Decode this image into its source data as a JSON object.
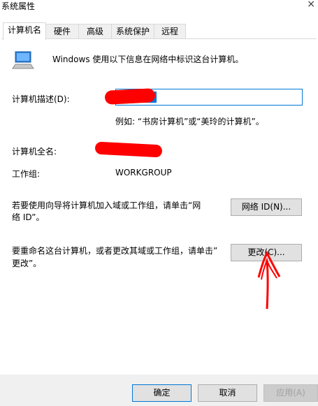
{
  "window": {
    "title": "系统属性",
    "close_glyph": "×"
  },
  "tabs": [
    "计算机名",
    "硬件",
    "高级",
    "系统保护",
    "远程"
  ],
  "intro_text": "Windows 使用以下信息在网络中标识这台计算机。",
  "description": {
    "label": "计算机描述(D):",
    "example": "例如: “书房计算机”或“美玲的计算机”。"
  },
  "full_name": {
    "label": "计算机全名:"
  },
  "workgroup": {
    "label": "工作组:",
    "value": "WORKGROUP"
  },
  "network_section": {
    "text_line1": "若要使用向导将计算机加入域或工作组，请单击“网",
    "text_line2": "络 ID”。",
    "button": "网络 ID(N)..."
  },
  "rename_section": {
    "text_line1": "要重命名这台计算机，或者更改其域或工作组，请单击”",
    "text_line2": "更改”。",
    "button": "更改(C)..."
  },
  "footer": {
    "ok": "确定",
    "cancel": "取消",
    "apply": "应用(A)"
  },
  "colors": {
    "accent": "#0078d7",
    "annotation": "#ff0000"
  }
}
